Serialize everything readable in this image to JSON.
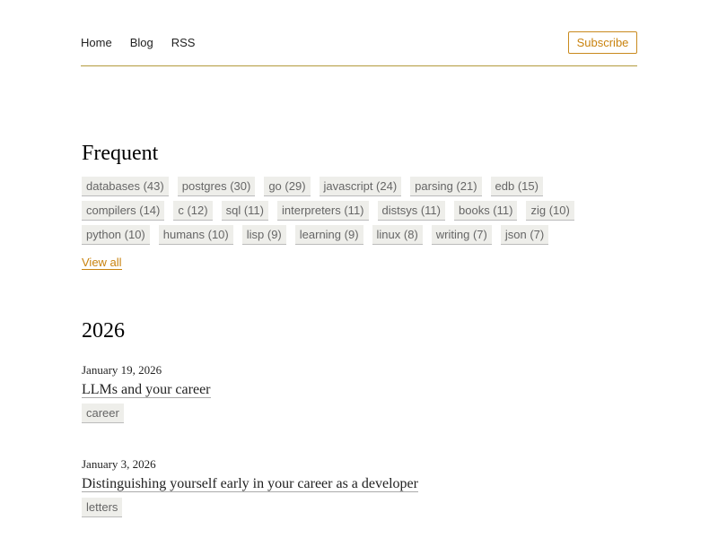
{
  "nav": {
    "items": [
      {
        "label": "Home"
      },
      {
        "label": "Blog"
      },
      {
        "label": "RSS"
      }
    ],
    "subscribe_label": "Subscribe"
  },
  "frequent": {
    "heading": "Frequent",
    "rows": [
      [
        "databases (43)",
        "postgres (30)",
        "go (29)",
        "javascript (24)",
        "parsing (21)",
        "edb (15)"
      ],
      [
        "compilers (14)",
        "c (12)",
        "sql (11)",
        "interpreters (11)",
        "distsys (11)",
        "books (11)",
        "zig (10)"
      ],
      [
        "python (10)",
        "humans (10)",
        "lisp (9)",
        "learning (9)",
        "linux (8)",
        "writing (7)",
        "json (7)"
      ]
    ],
    "view_all_label": "View all"
  },
  "year": {
    "heading": "2026",
    "posts": [
      {
        "date": "January 19, 2026",
        "title": "LLMs and your career",
        "tags": [
          "career"
        ]
      },
      {
        "date": "January 3, 2026",
        "title": "Distinguishing yourself early in your career as a developer",
        "tags": [
          "letters"
        ]
      }
    ]
  },
  "colors": {
    "accent": "#c9830f",
    "rule": "#b39a3c",
    "tag_bg": "#eeeeea"
  }
}
